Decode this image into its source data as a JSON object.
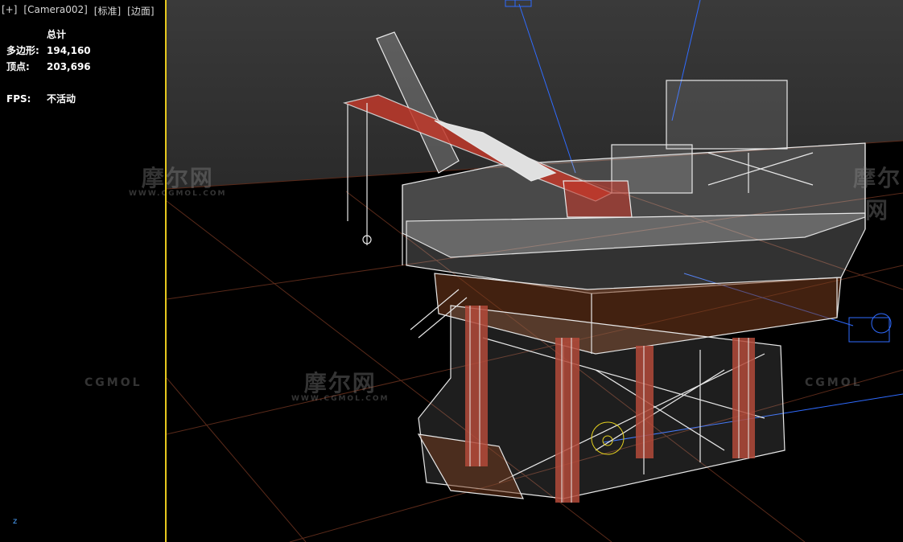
{
  "viewport": {
    "menu": [
      "[+]",
      "[Camera002]",
      "[标准]",
      "[边面]"
    ],
    "stats": {
      "header": "总计",
      "rows": [
        {
          "label": "多边形:",
          "value": "194,160"
        },
        {
          "label": "顶点:",
          "value": "203,696"
        }
      ],
      "fps_label": "FPS:",
      "fps_value": "不活动"
    },
    "axis_label": "z"
  },
  "watermarks": {
    "cn": "摩尔网",
    "en": "WWW.CGMOL.COM",
    "line": "CGMOL"
  },
  "colors": {
    "background": "#000000",
    "grid": "#5a2a1a",
    "wire": "#e8e8e8",
    "accent_red": "#c0392b",
    "active_border": "#e6c81e",
    "helper_blue": "#2f6bff"
  }
}
